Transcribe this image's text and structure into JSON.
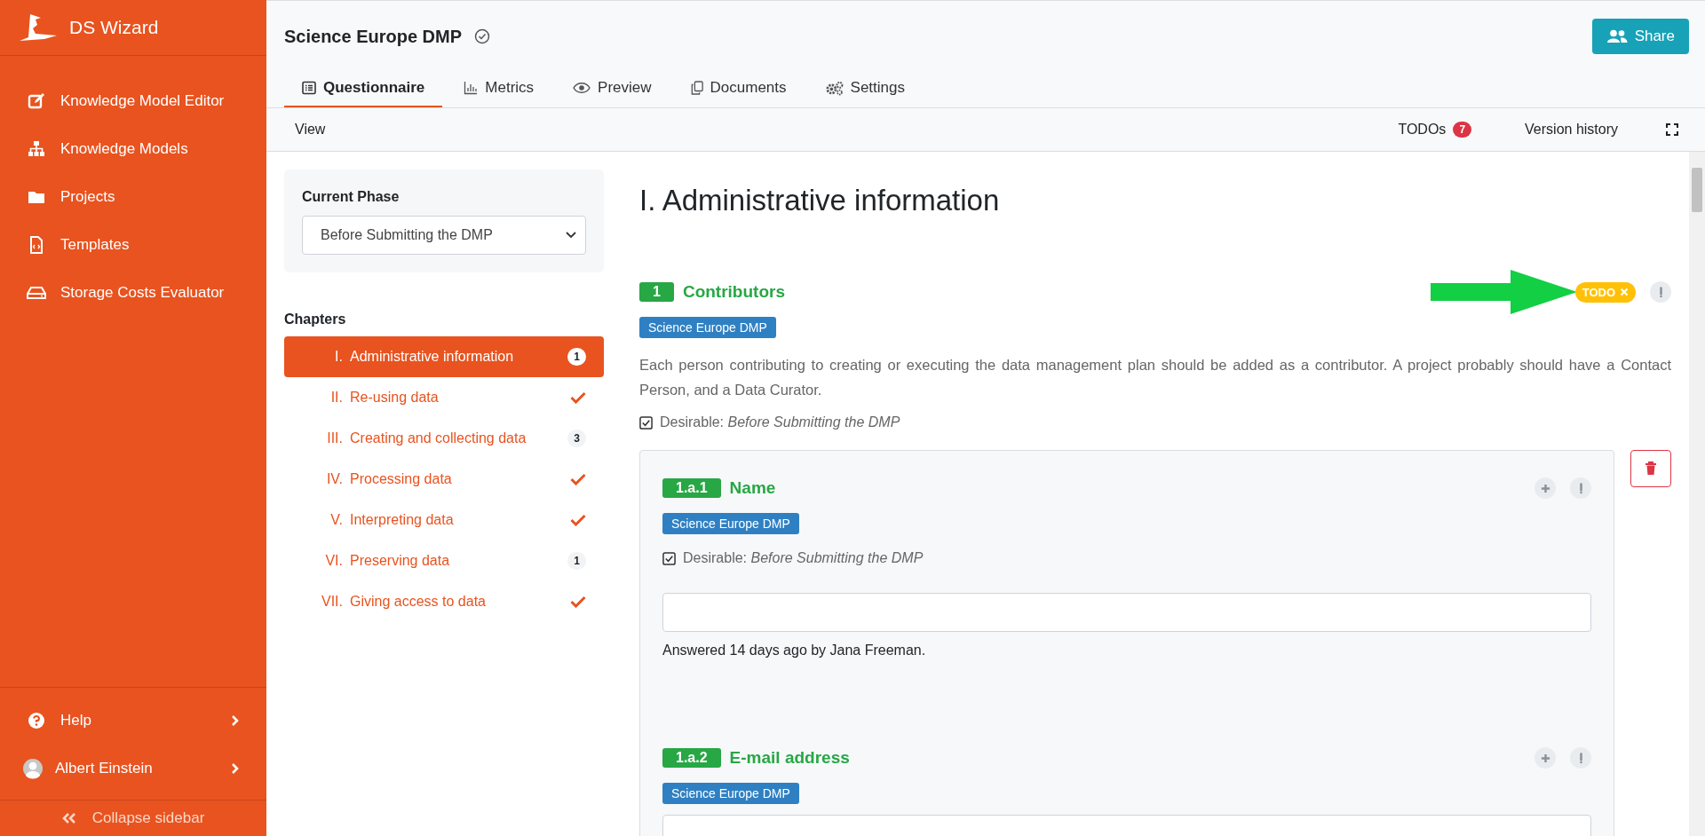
{
  "sidebar": {
    "brand": "DS Wizard",
    "items": [
      {
        "label": "Knowledge Model Editor",
        "kind": "edit"
      },
      {
        "label": "Knowledge Models",
        "kind": "tree"
      },
      {
        "label": "Projects",
        "kind": "folder"
      },
      {
        "label": "Templates",
        "kind": "file"
      },
      {
        "label": "Storage Costs Evaluator",
        "kind": "drive"
      }
    ],
    "help": "Help",
    "user": "Albert Einstein",
    "collapse": "Collapse sidebar"
  },
  "header": {
    "title": "Science Europe DMP",
    "share": "Share",
    "tabs": [
      {
        "label": "Questionnaire",
        "kind": "list",
        "selected": true
      },
      {
        "label": "Metrics",
        "kind": "chart",
        "selected": false
      },
      {
        "label": "Preview",
        "kind": "eye",
        "selected": false
      },
      {
        "label": "Documents",
        "kind": "copy",
        "selected": false
      },
      {
        "label": "Settings",
        "kind": "gears",
        "selected": false
      }
    ]
  },
  "toolbar": {
    "view": "View",
    "todos": "TODOs",
    "todo_count": "7",
    "version_history": "Version history"
  },
  "phase": {
    "label": "Current Phase",
    "value": "Before Submitting the DMP"
  },
  "chapters": {
    "heading": "Chapters",
    "items": [
      {
        "number": "I.",
        "title": "Administrative information",
        "selected": true,
        "kind": "count",
        "count": "1"
      },
      {
        "number": "II.",
        "title": "Re-using data",
        "selected": false,
        "kind": "done"
      },
      {
        "number": "III.",
        "title": "Creating and collecting data",
        "selected": false,
        "kind": "count",
        "count": "3"
      },
      {
        "number": "IV.",
        "title": "Processing data",
        "selected": false,
        "kind": "done"
      },
      {
        "number": "V.",
        "title": "Interpreting data",
        "selected": false,
        "kind": "done"
      },
      {
        "number": "VI.",
        "title": "Preserving data",
        "selected": false,
        "kind": "count",
        "count": "1"
      },
      {
        "number": "VII.",
        "title": "Giving access to data",
        "selected": false,
        "kind": "done"
      }
    ]
  },
  "content": {
    "heading": "I. Administrative information",
    "question": {
      "number": "1",
      "title": "Contributors",
      "tag": "Science Europe DMP",
      "todo": "TODO",
      "description": "Each person contributing to creating or executing the data management plan should be added as a contributor. A project probably should have a Contact Person, and a Data Curator.",
      "desirable": "Desirable: *Before Submitting the DMP*"
    },
    "items": [
      {
        "number": "1.a.1",
        "title": "Name",
        "tag": "Science Europe DMP",
        "desirable": "Desirable: *Before Submitting the DMP*",
        "answered": "Answered 14 days ago by Jana Freeman."
      },
      {
        "number": "1.a.2",
        "title": "E-mail address",
        "tag": "Science Europe DMP"
      }
    ]
  }
}
